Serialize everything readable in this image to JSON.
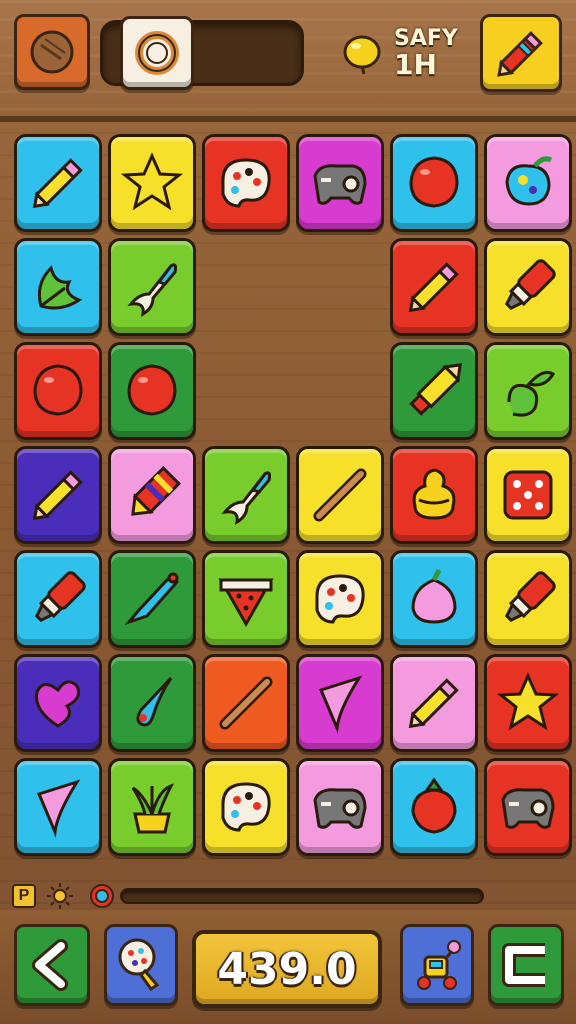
{
  "header": {
    "save_label": "SAFY",
    "save_value": "1H"
  },
  "score": {
    "value": "439.0"
  },
  "bottom": {
    "badge": "P"
  },
  "colors": {
    "cyan": "#2fc0ec",
    "yellow": "#f7e02a",
    "red": "#e63324",
    "magenta": "#d83bd0",
    "pink": "#f49be0",
    "lime": "#78cc2c",
    "green": "#2f9a3a",
    "indigo": "#4a2dba",
    "orange": "#ef5a20"
  },
  "tiles": [
    {
      "col": 0,
      "row": 0,
      "color": "cyan",
      "icon": "pencil-icon"
    },
    {
      "col": 1,
      "row": 0,
      "color": "yellow",
      "icon": "star-icon"
    },
    {
      "col": 2,
      "row": 0,
      "color": "red",
      "icon": "palette-icon"
    },
    {
      "col": 3,
      "row": 0,
      "color": "magenta",
      "icon": "gamepad-icon"
    },
    {
      "col": 4,
      "row": 0,
      "color": "cyan",
      "icon": "balloon-icon"
    },
    {
      "col": 5,
      "row": 0,
      "color": "pink",
      "icon": "paint-apple-icon"
    },
    {
      "col": 0,
      "row": 1,
      "color": "cyan",
      "icon": "leaf-icon"
    },
    {
      "col": 1,
      "row": 1,
      "color": "lime",
      "icon": "rocket-icon"
    },
    {
      "col": 4,
      "row": 1,
      "color": "red",
      "icon": "pencil-icon"
    },
    {
      "col": 5,
      "row": 1,
      "color": "yellow",
      "icon": "marker-icon"
    },
    {
      "col": 0,
      "row": 2,
      "color": "red",
      "icon": "balloon-icon"
    },
    {
      "col": 1,
      "row": 2,
      "color": "green",
      "icon": "balloon-icon"
    },
    {
      "col": 4,
      "row": 2,
      "color": "green",
      "icon": "crayon-icon"
    },
    {
      "col": 5,
      "row": 2,
      "color": "lime",
      "icon": "snake-leaf-icon"
    },
    {
      "col": 0,
      "row": 3,
      "color": "indigo",
      "icon": "pencil-icon"
    },
    {
      "col": 1,
      "row": 3,
      "color": "pink",
      "icon": "striped-crayon-icon"
    },
    {
      "col": 2,
      "row": 3,
      "color": "lime",
      "icon": "rocket-icon"
    },
    {
      "col": 3,
      "row": 3,
      "color": "yellow",
      "icon": "stick-icon"
    },
    {
      "col": 4,
      "row": 3,
      "color": "red",
      "icon": "icecream-icon"
    },
    {
      "col": 5,
      "row": 3,
      "color": "yellow",
      "icon": "dice-icon"
    },
    {
      "col": 0,
      "row": 4,
      "color": "cyan",
      "icon": "marker-icon"
    },
    {
      "col": 1,
      "row": 4,
      "color": "green",
      "icon": "brush-icon"
    },
    {
      "col": 2,
      "row": 4,
      "color": "lime",
      "icon": "watermelon-icon"
    },
    {
      "col": 3,
      "row": 4,
      "color": "yellow",
      "icon": "palette-icon"
    },
    {
      "col": 4,
      "row": 4,
      "color": "cyan",
      "icon": "berry-icon"
    },
    {
      "col": 5,
      "row": 4,
      "color": "yellow",
      "icon": "marker-icon"
    },
    {
      "col": 0,
      "row": 5,
      "color": "indigo",
      "icon": "heart-icon"
    },
    {
      "col": 1,
      "row": 5,
      "color": "green",
      "icon": "drop-icon"
    },
    {
      "col": 2,
      "row": 5,
      "color": "orange",
      "icon": "stick-icon"
    },
    {
      "col": 3,
      "row": 5,
      "color": "magenta",
      "icon": "cone-icon"
    },
    {
      "col": 4,
      "row": 5,
      "color": "pink",
      "icon": "pencil-icon"
    },
    {
      "col": 5,
      "row": 5,
      "color": "red",
      "icon": "star-icon"
    },
    {
      "col": 0,
      "row": 6,
      "color": "cyan",
      "icon": "cone-icon"
    },
    {
      "col": 1,
      "row": 6,
      "color": "lime",
      "icon": "plant-icon"
    },
    {
      "col": 2,
      "row": 6,
      "color": "yellow",
      "icon": "palette-icon"
    },
    {
      "col": 3,
      "row": 6,
      "color": "pink",
      "icon": "gamepad-icon"
    },
    {
      "col": 4,
      "row": 6,
      "color": "cyan",
      "icon": "strawberry-icon"
    },
    {
      "col": 5,
      "row": 6,
      "color": "red",
      "icon": "gamepad-icon"
    }
  ]
}
